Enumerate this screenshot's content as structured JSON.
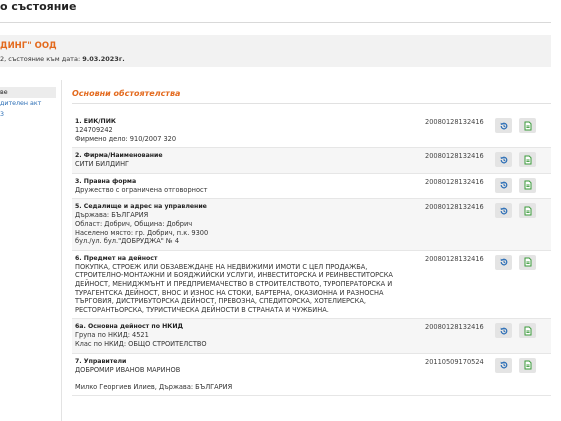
{
  "page": {
    "title": "о състояние"
  },
  "company": {
    "name": "ДИНГ\" ООД",
    "sub_prefix": "2, състояние към дата:",
    "sub_date": "9.03.2023г."
  },
  "sidebar": {
    "items": [
      "ве",
      "дителен акт",
      "3"
    ]
  },
  "section": {
    "title": "Основни обстоятелства"
  },
  "rows": [
    {
      "title": "1. ЕИК/ПИК",
      "lines": [
        "124709242",
        "Фирмено дело: 910/2007 320"
      ],
      "date": "20080128132416"
    },
    {
      "title": "2. Фирма/Наименование",
      "lines": [
        "СИТИ БИЛДИНГ"
      ],
      "date": "20080128132416"
    },
    {
      "title": "3. Правна форма",
      "lines": [
        "Дружество с ограничена отговорност"
      ],
      "date": "20080128132416"
    },
    {
      "title": "5. Седалище и адрес на управление",
      "lines": [
        "Държава: БЪЛГАРИЯ",
        "Област: Добрич, Община: Добрич",
        "Населено място: гр. Добрич, п.к. 9300",
        "бул./ул. бул.\"ДОБРУДЖА\" № 4"
      ],
      "date": "20080128132416"
    },
    {
      "title": "6. Предмет на дейност",
      "lines": [
        "ПОКУПКА, СТРОЕЖ ИЛИ ОБЗАВЕЖДАНЕ НА НЕДВИЖИМИ ИМОТИ С ЦЕЛ ПРОДАЖБА,",
        "СТРОИТЕЛНО-МОНТАЖНИ И БОЯДЖИЙСКИ УСЛУГИ, ИНВЕСТИТОРСКА И РЕИНВЕСТИТОРСКА",
        "ДЕЙНОСТ, МЕНИДЖМЪНТ И ПРЕДПРИЕМАЧЕСТВО В СТРОИТЕЛСТВОТО, ТУРОПЕРАТОРСКА И",
        "ТУРАГЕНТСКА ДЕЙНОСТ, ВНОС И ИЗНОС НА СТОКИ, БАРТЕРНА, ОКАЗИОННА И РАЗНОСНА",
        "ТЪРГОВИЯ, ДИСТРИБУТОРСКА ДЕЙНОСТ, ПРЕВОЗНА, СПЕДИТОРСКА, ХОТЕЛИЕРСКА,",
        "РЕСТОРАНТЬОРСКА, ТУРИСТИЧЕСКА ДЕЙНОСТИ В СТРАНАТА И ЧУЖБИНА."
      ],
      "date": "20080128132416"
    },
    {
      "title": "6а. Основна дейност по НКИД",
      "lines": [
        "Група по НКИД: 4521",
        "Клас по НКИД: ОБЩО СТРОИТЕЛСТВО"
      ],
      "date": "20080128132416"
    },
    {
      "title": "7. Управители",
      "lines": [
        "ДОБРОМИР ИВАНОВ МАРИНОВ",
        "",
        "Милко Георгиев Илиев, Държава: БЪЛГАРИЯ"
      ],
      "date": "20110509170524"
    }
  ],
  "icons": {
    "history": "history-icon",
    "document": "document-icon"
  },
  "colors": {
    "accent": "#e36a1e",
    "icon_blue": "#2a6db5",
    "icon_green": "#3a9a3a"
  }
}
